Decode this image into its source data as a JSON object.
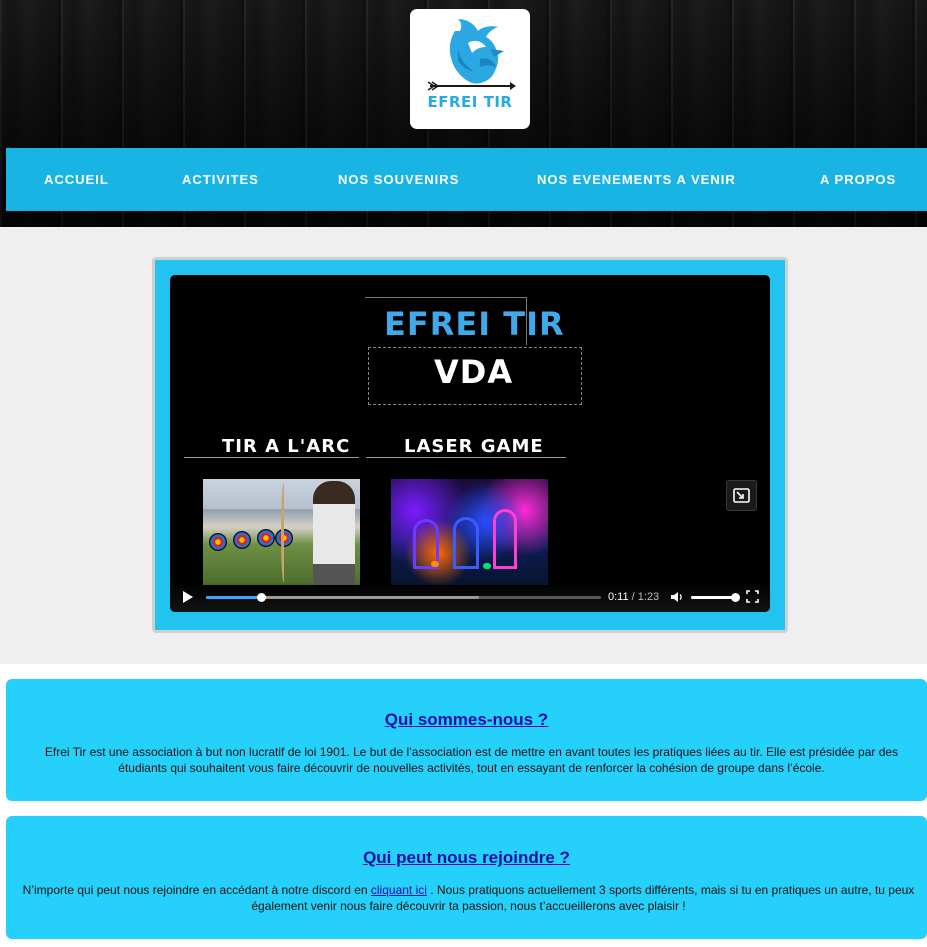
{
  "logo": {
    "text": "EFREI TIR",
    "icon": "griffin-arrow-logo-icon",
    "color": "#29a9e1"
  },
  "nav": {
    "items": [
      {
        "label": "ACCUEIL"
      },
      {
        "label": "ACTIVITES"
      },
      {
        "label": "NOS SOUVENIRS"
      },
      {
        "label": "NOS EVENEMENTS A VENIR"
      },
      {
        "label": "A PROPOS"
      }
    ],
    "color": "#18b4e3"
  },
  "video": {
    "title": "EFREI TIR",
    "subtitle": "VDA",
    "activity_left": "TIR A L'ARC",
    "activity_right": "LASER GAME",
    "current_time": "0:11",
    "separator": " / ",
    "duration": "1:23",
    "progress": 0.14,
    "buffered": 0.69,
    "volume": 1.0
  },
  "cards": [
    {
      "heading": "Qui sommes-nous ?",
      "body": "Efrei Tir est une association à but non lucratif de loi 1901. Le but de l’association est de mettre en avant toutes les pratiques liées au tir. Elle est présidée par des étudiants qui souhaitent vous faire découvrir de nouvelles activités, tout en essayant de renforcer la cohésion de groupe dans l’école."
    },
    {
      "heading": "Qui peut nous rejoindre ?",
      "body_before": "N’importe qui peut nous rejoindre en accédant à notre discord en ",
      "link": "cliquant ici",
      "body_after": " . Nous pratiquons actuellement 3 sports différents, mais si tu en pratiques un autre, tu peux également venir nous faire découvrir ta passion, nous t’accueillerons avec plaisir !"
    }
  ],
  "colors": {
    "card": "#25d1fb",
    "link": "#1a0dab",
    "accent": "#3ea6ff"
  }
}
